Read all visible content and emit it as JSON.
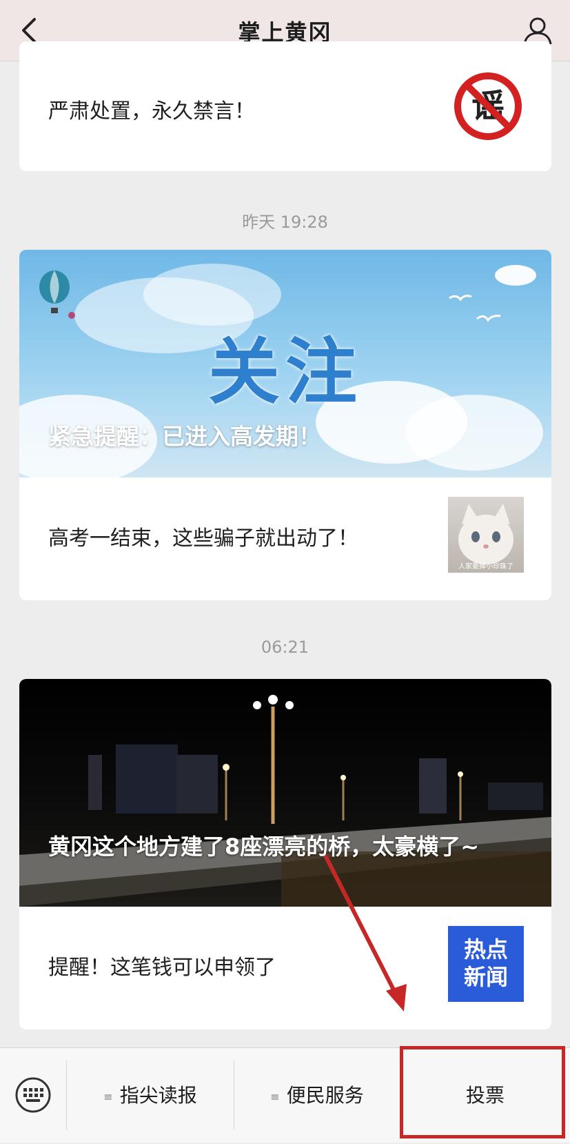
{
  "header": {
    "title": "掌上黄冈",
    "back_icon": "chevron-left-icon",
    "profile_icon": "person-icon"
  },
  "messages": [
    {
      "text": "严肃处置，永久禁言！",
      "thumbnail": "rumor-prohibited-icon",
      "thumbnail_text": "谣"
    },
    {
      "timestamp": "昨天 19:28",
      "banner_text": "关注",
      "banner_caption": "紧急提醒：已进入高发期！",
      "text": "高考一结束，这些骗子就出动了！",
      "thumbnail_caption": "人家要掉小珍珠了"
    },
    {
      "timestamp": "06:21",
      "banner_caption": "黄冈这个地方建了8座漂亮的桥，太豪横了~",
      "text": "提醒！这笔钱可以申领了",
      "thumbnail_text_line1": "热点",
      "thumbnail_text_line2": "新闻"
    }
  ],
  "bottom_menu": {
    "keyboard_icon": "keyboard-icon",
    "items": [
      {
        "label": "指尖读报",
        "icon": "≡"
      },
      {
        "label": "便民服务",
        "icon": "≡"
      },
      {
        "label": "投票"
      }
    ]
  },
  "colors": {
    "header_bg": "#f1e6e6",
    "annotation_red": "#c62828",
    "hot_news_blue": "#2a5bd8"
  }
}
